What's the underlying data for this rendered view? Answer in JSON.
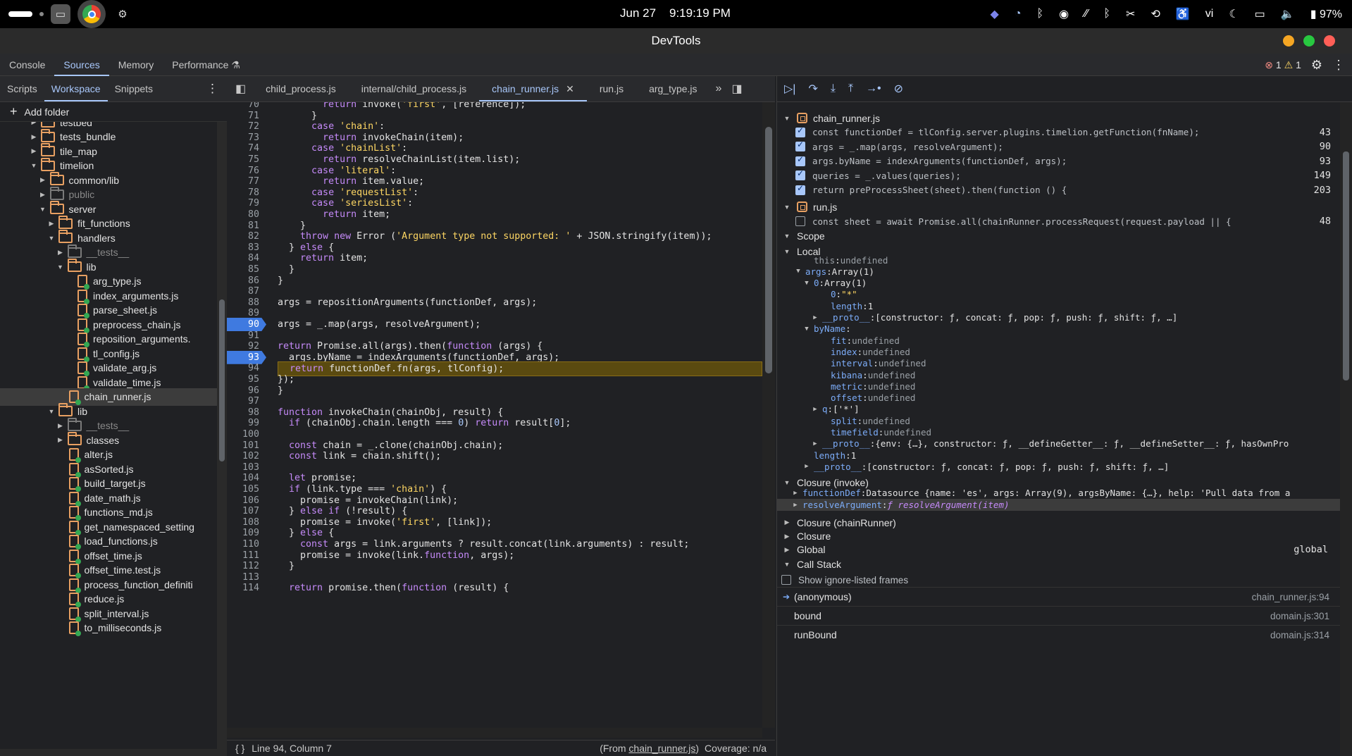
{
  "system": {
    "date": "Jun 27",
    "time": "9:19:19 PM",
    "input_method": "vi",
    "battery": "97%"
  },
  "window": {
    "title": "DevTools"
  },
  "panel_tabs": [
    "Console",
    "Sources",
    "Memory",
    "Performance"
  ],
  "issues": {
    "errors": "1",
    "warnings": "1"
  },
  "navigator": {
    "tabs": [
      "Scripts",
      "Workspace",
      "Snippets"
    ],
    "add_folder": "Add folder",
    "tree": [
      {
        "label": "testbed",
        "type": "folder",
        "depth": 0,
        "open": false
      },
      {
        "label": "tests_bundle",
        "type": "folder",
        "depth": 0,
        "open": false
      },
      {
        "label": "tile_map",
        "type": "folder",
        "depth": 0,
        "open": false
      },
      {
        "label": "timelion",
        "type": "folder",
        "depth": 0,
        "open": true
      },
      {
        "label": "common/lib",
        "type": "folder",
        "depth": 1,
        "open": false
      },
      {
        "label": "public",
        "type": "folder",
        "depth": 1,
        "open": false,
        "dim": true
      },
      {
        "label": "server",
        "type": "folder",
        "depth": 1,
        "open": true
      },
      {
        "label": "fit_functions",
        "type": "folder",
        "depth": 2,
        "open": false
      },
      {
        "label": "handlers",
        "type": "folder",
        "depth": 2,
        "open": true
      },
      {
        "label": "__tests__",
        "type": "folder",
        "depth": 3,
        "open": false,
        "dim": true
      },
      {
        "label": "lib",
        "type": "folder",
        "depth": 3,
        "open": true
      },
      {
        "label": "arg_type.js",
        "type": "file",
        "depth": 4
      },
      {
        "label": "index_arguments.js",
        "type": "file",
        "depth": 4
      },
      {
        "label": "parse_sheet.js",
        "type": "file",
        "depth": 4
      },
      {
        "label": "preprocess_chain.js",
        "type": "file",
        "depth": 4
      },
      {
        "label": "reposition_arguments.",
        "type": "file",
        "depth": 4
      },
      {
        "label": "tl_config.js",
        "type": "file",
        "depth": 4
      },
      {
        "label": "validate_arg.js",
        "type": "file",
        "depth": 4
      },
      {
        "label": "validate_time.js",
        "type": "file",
        "depth": 4
      },
      {
        "label": "chain_runner.js",
        "type": "file",
        "depth": 3,
        "selected": true
      },
      {
        "label": "lib",
        "type": "folder",
        "depth": 2,
        "open": true
      },
      {
        "label": "__tests__",
        "type": "folder",
        "depth": 3,
        "open": false,
        "dim": true
      },
      {
        "label": "classes",
        "type": "folder",
        "depth": 3,
        "open": false
      },
      {
        "label": "alter.js",
        "type": "file",
        "depth": 3
      },
      {
        "label": "asSorted.js",
        "type": "file",
        "depth": 3
      },
      {
        "label": "build_target.js",
        "type": "file",
        "depth": 3
      },
      {
        "label": "date_math.js",
        "type": "file",
        "depth": 3
      },
      {
        "label": "functions_md.js",
        "type": "file",
        "depth": 3
      },
      {
        "label": "get_namespaced_setting",
        "type": "file",
        "depth": 3
      },
      {
        "label": "load_functions.js",
        "type": "file",
        "depth": 3
      },
      {
        "label": "offset_time.js",
        "type": "file",
        "depth": 3
      },
      {
        "label": "offset_time.test.js",
        "type": "file",
        "depth": 3
      },
      {
        "label": "process_function_definiti",
        "type": "file",
        "depth": 3
      },
      {
        "label": "reduce.js",
        "type": "file",
        "depth": 3
      },
      {
        "label": "split_interval.js",
        "type": "file",
        "depth": 3
      },
      {
        "label": "to_milliseconds.js",
        "type": "file",
        "depth": 3
      }
    ]
  },
  "editor_tabs": [
    {
      "label": "child_process.js",
      "active": false
    },
    {
      "label": "internal/child_process.js",
      "active": false
    },
    {
      "label": "chain_runner.js",
      "active": true
    },
    {
      "label": "run.js",
      "active": false
    },
    {
      "label": "arg_type.js",
      "active": false
    }
  ],
  "code": [
    {
      "n": "70",
      "t": "        return invoke('first', [reference]);"
    },
    {
      "n": "71",
      "t": "      }"
    },
    {
      "n": "72",
      "t": "      case 'chain':"
    },
    {
      "n": "73",
      "t": "        return invokeChain(item);"
    },
    {
      "n": "74",
      "t": "      case 'chainList':"
    },
    {
      "n": "75",
      "t": "        return resolveChainList(item.list);"
    },
    {
      "n": "76",
      "t": "      case 'literal':"
    },
    {
      "n": "77",
      "t": "        return item.value;"
    },
    {
      "n": "78",
      "t": "      case 'requestList':"
    },
    {
      "n": "79",
      "t": "      case 'seriesList':"
    },
    {
      "n": "80",
      "t": "        return item;"
    },
    {
      "n": "81",
      "t": "    }"
    },
    {
      "n": "82",
      "t": "    throw new Error ('Argument type not supported: ' + JSON.stringify(item));"
    },
    {
      "n": "83",
      "t": "  } else {"
    },
    {
      "n": "84",
      "t": "    return item;"
    },
    {
      "n": "85",
      "t": "  }"
    },
    {
      "n": "86",
      "t": "}"
    },
    {
      "n": "87",
      "t": ""
    },
    {
      "n": "88",
      "t": "args = repositionArguments(functionDef, args);"
    },
    {
      "n": "89",
      "t": ""
    },
    {
      "n": "90",
      "t": "args = _.map(args, resolveArgument);",
      "bp": true
    },
    {
      "n": "91",
      "t": ""
    },
    {
      "n": "92",
      "t": "return Promise.all(args).then(function (args) {"
    },
    {
      "n": "93",
      "t": "  args.byName = indexArguments(functionDef, args);",
      "bp": true
    },
    {
      "n": "94",
      "t": "  return functionDef.fn(args, tlConfig);",
      "exec": true
    },
    {
      "n": "95",
      "t": "});"
    },
    {
      "n": "96",
      "t": "}"
    },
    {
      "n": "97",
      "t": ""
    },
    {
      "n": "98",
      "t": "function invokeChain(chainObj, result) {"
    },
    {
      "n": "99",
      "t": "  if (chainObj.chain.length === 0) return result[0];"
    },
    {
      "n": "100",
      "t": ""
    },
    {
      "n": "101",
      "t": "  const chain = _.clone(chainObj.chain);"
    },
    {
      "n": "102",
      "t": "  const link = chain.shift();"
    },
    {
      "n": "103",
      "t": ""
    },
    {
      "n": "104",
      "t": "  let promise;"
    },
    {
      "n": "105",
      "t": "  if (link.type === 'chain') {"
    },
    {
      "n": "106",
      "t": "    promise = invokeChain(link);"
    },
    {
      "n": "107",
      "t": "  } else if (!result) {"
    },
    {
      "n": "108",
      "t": "    promise = invoke('first', [link]);"
    },
    {
      "n": "109",
      "t": "  } else {"
    },
    {
      "n": "110",
      "t": "    const args = link.arguments ? result.concat(link.arguments) : result;"
    },
    {
      "n": "111",
      "t": "    promise = invoke(link.function, args);"
    },
    {
      "n": "112",
      "t": "  }"
    },
    {
      "n": "113",
      "t": ""
    },
    {
      "n": "114",
      "t": "  return promise.then(function (result) {"
    }
  ],
  "status": {
    "position": "Line 94, Column 7",
    "from_prefix": "(From ",
    "from_file": "chain_runner.js",
    "from_suffix": ")",
    "coverage": "Coverage: n/a"
  },
  "breakpoints": {
    "groups": [
      {
        "file": "chain_runner.js",
        "items": [
          {
            "text": "const functionDef = tlConfig.server.plugins.timelion.getFunction(fnName);",
            "line": "43",
            "checked": true
          },
          {
            "text": "args = _.map(args, resolveArgument);",
            "line": "90",
            "checked": true
          },
          {
            "text": "args.byName = indexArguments(functionDef, args);",
            "line": "93",
            "checked": true
          },
          {
            "text": "queries = _.values(queries);",
            "line": "149",
            "checked": true
          },
          {
            "text": "return preProcessSheet(sheet).then(function () {",
            "line": "203",
            "checked": true
          }
        ]
      },
      {
        "file": "run.js",
        "items": [
          {
            "text": "const sheet = await Promise.all(chainRunner.processRequest(request.payload || {",
            "line": "48",
            "checked": false
          }
        ]
      }
    ]
  },
  "scope": {
    "title": "Scope",
    "local": "Local",
    "rows": [
      {
        "indent": 2,
        "tri": "",
        "key": "this",
        "sep": ": ",
        "val": "undefined",
        "cls": "vundef",
        "plain": true
      },
      {
        "indent": 1,
        "tri": "▼",
        "key": "args",
        "sep": ": ",
        "val": "Array(1)",
        "cls": "vobj"
      },
      {
        "indent": 2,
        "tri": "▼",
        "key": "0",
        "sep": ": ",
        "val": "Array(1)",
        "cls": "vobj"
      },
      {
        "indent": 4,
        "tri": "",
        "key": "0",
        "sep": ": ",
        "val": "\"*\"",
        "cls": "vstr"
      },
      {
        "indent": 4,
        "tri": "",
        "key": "length",
        "sep": ": ",
        "val": "1",
        "cls": "vobj"
      },
      {
        "indent": 3,
        "tri": "▶",
        "key": "__proto__",
        "sep": ": ",
        "val": "[constructor: ƒ, concat: ƒ, pop: ƒ, push: ƒ, shift: ƒ, …]",
        "cls": "vobj"
      },
      {
        "indent": 2,
        "tri": "▼",
        "key": "byName",
        "sep": ":",
        "val": "",
        "cls": "vobj"
      },
      {
        "indent": 4,
        "tri": "",
        "key": "fit",
        "sep": ": ",
        "val": "undefined",
        "cls": "vundef"
      },
      {
        "indent": 4,
        "tri": "",
        "key": "index",
        "sep": ": ",
        "val": "undefined",
        "cls": "vundef"
      },
      {
        "indent": 4,
        "tri": "",
        "key": "interval",
        "sep": ": ",
        "val": "undefined",
        "cls": "vundef"
      },
      {
        "indent": 4,
        "tri": "",
        "key": "kibana",
        "sep": ": ",
        "val": "undefined",
        "cls": "vundef"
      },
      {
        "indent": 4,
        "tri": "",
        "key": "metric",
        "sep": ": ",
        "val": "undefined",
        "cls": "vundef"
      },
      {
        "indent": 4,
        "tri": "",
        "key": "offset",
        "sep": ": ",
        "val": "undefined",
        "cls": "vundef"
      },
      {
        "indent": 3,
        "tri": "▶",
        "key": "q",
        "sep": ": ",
        "val": "['*']",
        "cls": "vobj"
      },
      {
        "indent": 4,
        "tri": "",
        "key": "split",
        "sep": ": ",
        "val": "undefined",
        "cls": "vundef"
      },
      {
        "indent": 4,
        "tri": "",
        "key": "timefield",
        "sep": ": ",
        "val": "undefined",
        "cls": "vundef"
      },
      {
        "indent": 3,
        "tri": "▶",
        "key": "__proto__",
        "sep": ": ",
        "val": "{env: {…}, constructor: ƒ, __defineGetter__: ƒ, __defineSetter__: ƒ, hasOwnPro",
        "cls": "vobj"
      },
      {
        "indent": 2,
        "tri": "",
        "key": "length",
        "sep": ": ",
        "val": "1",
        "cls": "vobj"
      },
      {
        "indent": 2,
        "tri": "▶",
        "key": "__proto__",
        "sep": ": ",
        "val": "[constructor: ƒ, concat: ƒ, pop: ƒ, push: ƒ, shift: ƒ, …]",
        "cls": "vobj"
      }
    ],
    "closure_invoke": "Closure (invoke)",
    "closure_rows": [
      {
        "key": "functionDef",
        "val": "Datasource {name: 'es', args: Array(9), argsByName: {…}, help: 'Pull data from a",
        "cls": "vobj"
      },
      {
        "key": "resolveArgument",
        "val": "ƒ resolveArgument(item)",
        "cls": "vfn",
        "selected": true
      }
    ],
    "closure_chain": "Closure (chainRunner)",
    "closure": "Closure",
    "global": "Global",
    "global_val": "global"
  },
  "call_stack": {
    "title": "Call Stack",
    "show_ignored": "Show ignore-listed frames",
    "frames": [
      {
        "name": "(anonymous)",
        "loc": "chain_runner.js:94",
        "current": true
      },
      {
        "name": "bound",
        "loc": "domain.js:301"
      },
      {
        "name": "runBound",
        "loc": "domain.js:314"
      }
    ]
  }
}
